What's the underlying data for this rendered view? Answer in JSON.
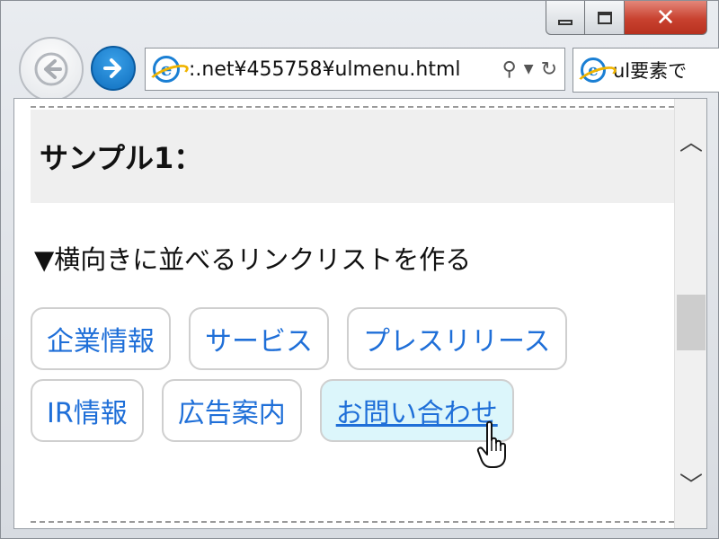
{
  "browser": {
    "address_url": ":.net¥455758¥ulmenu.html",
    "tab_title": "ul要素で",
    "search_icon": "search-icon",
    "refresh_icon": "refresh-icon"
  },
  "page": {
    "heading": "サンプル1：",
    "subtitle": "▼横向きに並べるリンクリストを作る",
    "menu_rows": [
      [
        "企業情報",
        "サービス",
        "プレスリリース"
      ],
      [
        "IR情報",
        "広告案内",
        "お問い合わせ"
      ]
    ],
    "hovered_item": "お問い合わせ"
  },
  "colors": {
    "link": "#1f6fd8",
    "hover_bg": "#dcf6fb",
    "heading_bg": "#efefef",
    "close_button": "#c8412f",
    "forward_button": "#0f6fbf"
  }
}
